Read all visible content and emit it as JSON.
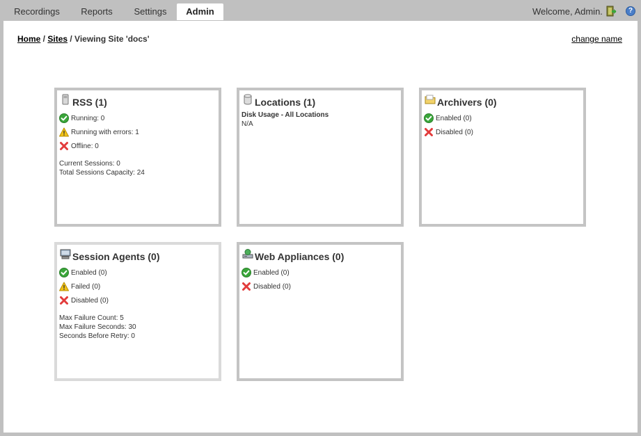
{
  "nav": {
    "tabs": [
      {
        "label": "Recordings"
      },
      {
        "label": "Reports"
      },
      {
        "label": "Settings"
      },
      {
        "label": "Admin"
      }
    ],
    "welcome": "Welcome, Admin."
  },
  "breadcrumb": {
    "home": "Home",
    "sep1": " / ",
    "sites": "Sites",
    "current": " / Viewing Site 'docs'"
  },
  "change_name": "change name",
  "cards": {
    "rss": {
      "title": "RSS (1)",
      "running": "Running: 0",
      "running_errors": "Running with errors: 1",
      "offline": "Offline: 0",
      "current_sessions": "Current Sessions: 0",
      "total_capacity": "Total Sessions Capacity: 24"
    },
    "locations": {
      "title": "Locations (1)",
      "disk_usage_label": "Disk Usage - All Locations",
      "disk_usage_value": "N/A"
    },
    "archivers": {
      "title": "Archivers (0)",
      "enabled": "Enabled (0)",
      "disabled": "Disabled (0)"
    },
    "session_agents": {
      "title": "Session Agents (0)",
      "enabled": "Enabled (0)",
      "failed": "Failed (0)",
      "disabled": "Disabled (0)",
      "max_failure_count": "Max Failure Count: 5",
      "max_failure_seconds": "Max Failure Seconds: 30",
      "seconds_before_retry": "Seconds Before Retry: 0"
    },
    "web_appliances": {
      "title": "Web Appliances (0)",
      "enabled": "Enabled (0)",
      "disabled": "Disabled (0)"
    }
  },
  "colors": {
    "ok": "#3aa63a",
    "warn": "#f2c418",
    "error": "#e23b3b",
    "card_border": "#c4c4c4",
    "background": "#c0c0c0"
  },
  "icons": {
    "ok": "check-circle-icon",
    "warn": "warning-triangle-icon",
    "error": "red-x-icon"
  }
}
